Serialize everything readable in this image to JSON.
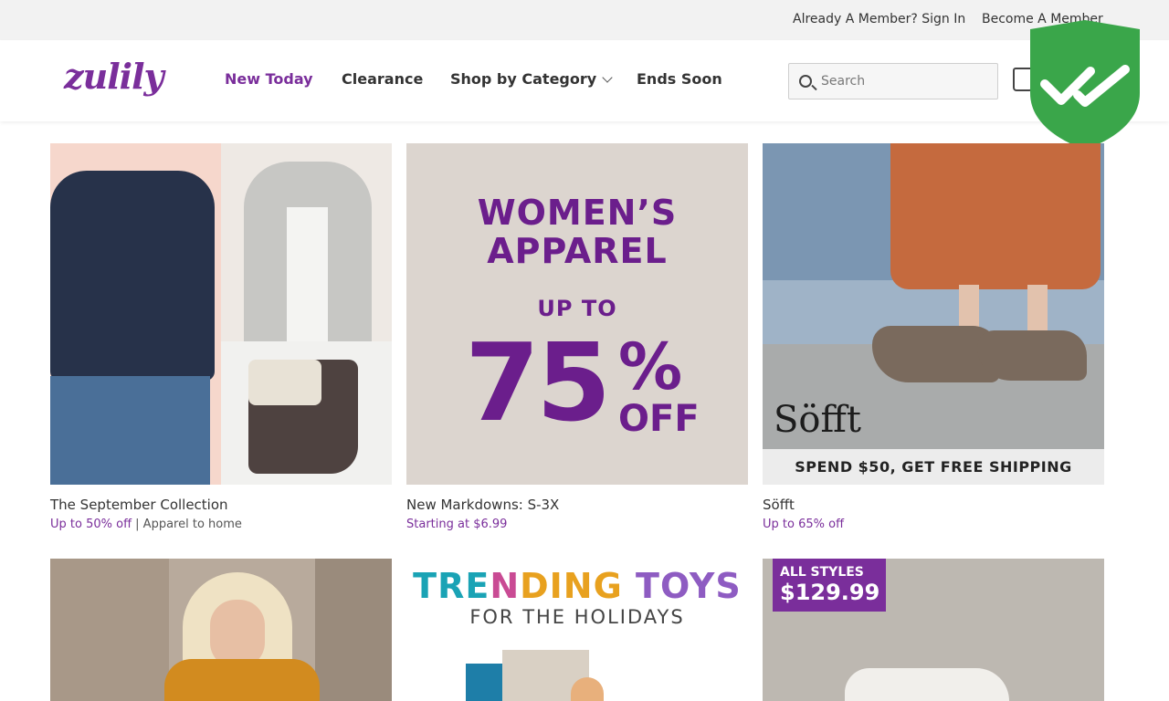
{
  "topbar": {
    "signin": "Already A Member? Sign In",
    "become_member": "Become A Member"
  },
  "header": {
    "logo": "zulily",
    "nav": [
      "New Today",
      "Clearance",
      "Shop by Category",
      "Ends Soon"
    ],
    "search_placeholder": "Search"
  },
  "colors": {
    "brand": "#7a2e9b",
    "shield_green": "#3aa64a"
  },
  "products": [
    {
      "title": "The September Collection",
      "discount": "Up to 50% off",
      "extra": " | Apparel to home"
    },
    {
      "title": "New Markdowns: S-3X",
      "discount": "Starting at $6.99",
      "extra": "",
      "banner": {
        "line1": "WOMEN’S",
        "line2": "APPAREL",
        "up_to": "UP TO",
        "number": "75",
        "pct": "%",
        "off": "OFF"
      }
    },
    {
      "title": "Söfft",
      "discount": "Up to 65% off",
      "extra": "",
      "banner": {
        "brand": "Söfft",
        "shipping": "SPEND $50, GET FREE SHIPPING"
      }
    },
    {
      "title": "",
      "discount": "",
      "extra": ""
    },
    {
      "title": "",
      "discount": "",
      "extra": "",
      "banner": {
        "t1": "TRE",
        "t2": "N",
        "t3": "DING",
        "t4": "TOYS",
        "sub": "FOR THE HOLIDAYS"
      }
    },
    {
      "title": "",
      "discount": "",
      "extra": "",
      "banner": {
        "all_styles": "ALL STYLES",
        "price": "$129.99"
      }
    }
  ]
}
